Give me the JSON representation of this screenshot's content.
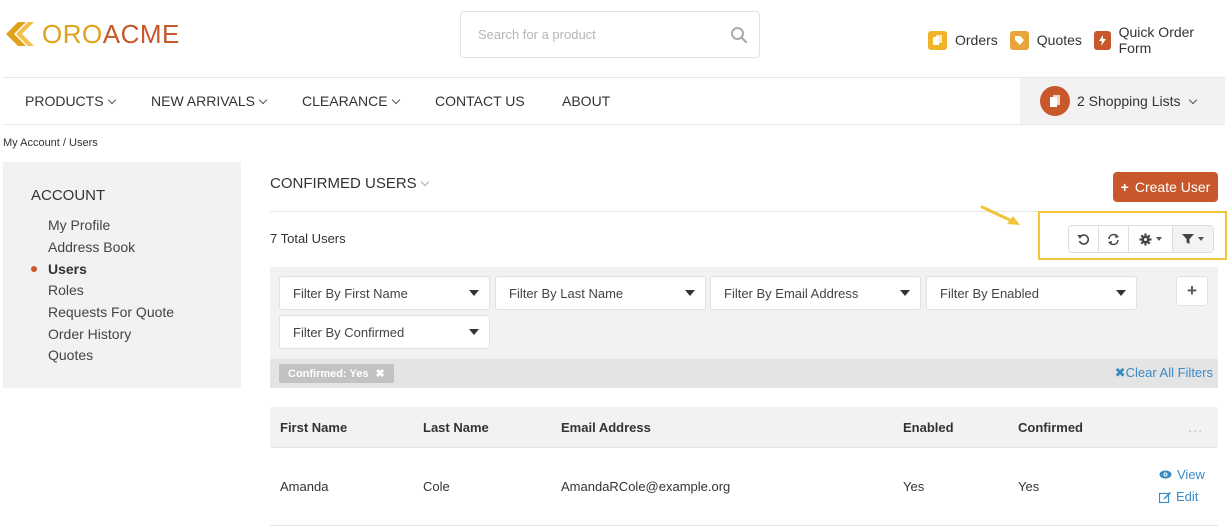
{
  "brand": {
    "oro": "ORO",
    "acme": "ACME",
    "oro_color": "#e0a21a",
    "acme_color": "#c8582b"
  },
  "search": {
    "placeholder": "Search for a product",
    "icon": "search-icon"
  },
  "top_links": [
    {
      "label": "Orders",
      "icon": "orders-icon",
      "color": "#f0b429"
    },
    {
      "label": "Quotes",
      "icon": "quotes-icon",
      "color": "#e8a53c"
    },
    {
      "label": "Quick Order Form",
      "icon": "quick-order-icon",
      "color": "#c8582b"
    }
  ],
  "nav": {
    "items": [
      {
        "label": "PRODUCTS",
        "dropdown": true
      },
      {
        "label": "NEW ARRIVALS",
        "dropdown": true
      },
      {
        "label": "CLEARANCE",
        "dropdown": true
      },
      {
        "label": "CONTACT US",
        "dropdown": false
      },
      {
        "label": "ABOUT",
        "dropdown": false
      }
    ],
    "shopping_lists": "2 Shopping Lists"
  },
  "breadcrumb": "My Account / Users",
  "sidebar": {
    "title": "ACCOUNT",
    "items": [
      {
        "label": "My Profile",
        "active": false
      },
      {
        "label": "Address Book",
        "active": false
      },
      {
        "label": "Users",
        "active": true
      },
      {
        "label": "Roles",
        "active": false
      },
      {
        "label": "Requests For Quote",
        "active": false
      },
      {
        "label": "Order History",
        "active": false
      },
      {
        "label": "Quotes",
        "active": false
      }
    ]
  },
  "main": {
    "title": "CONFIRMED USERS",
    "create_button": "Create User",
    "total": "7 Total Users",
    "filters": [
      "Filter By First Name",
      "Filter By Last Name",
      "Filter By Email Address",
      "Filter By Enabled",
      "Filter By Confirmed"
    ],
    "active_filter": "Confirmed: Yes",
    "clear_all": "Clear All Filters",
    "columns": [
      "First Name",
      "Last Name",
      "Email Address",
      "Enabled",
      "Confirmed"
    ],
    "rows": [
      {
        "first_name": "Amanda",
        "last_name": "Cole",
        "email": "AmandaRCole@example.org",
        "enabled": "Yes",
        "confirmed": "Yes",
        "view": "View",
        "edit": "Edit"
      }
    ],
    "ellipsis": "..."
  },
  "colors": {
    "accent": "#c8582b",
    "link": "#3b8ac4",
    "highlight": "#f0c53a"
  }
}
